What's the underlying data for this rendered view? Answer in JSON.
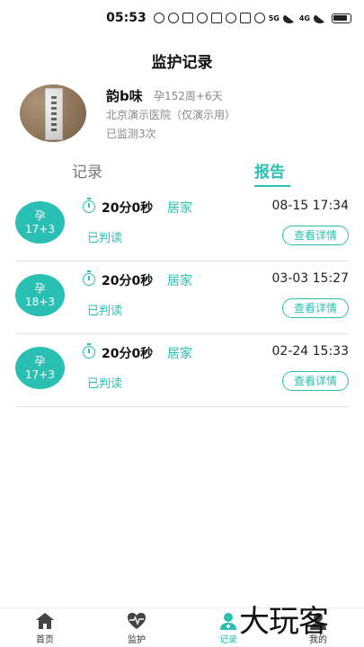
{
  "status_bar": {
    "time": "05:53",
    "icons": [
      "speed-icon",
      "eye-icon",
      "nfc-icon",
      "alarm-icon",
      "bluetooth-icon",
      "moon-icon",
      "vibrate-icon",
      "wifi-icon",
      "signal-icon",
      "signal-icon",
      "battery-icon"
    ],
    "net_5g": "5G",
    "net_4g": "4G"
  },
  "header": {
    "title": "监护记录"
  },
  "profile": {
    "name": "韵b味",
    "pregnancy": "孕152周+6天",
    "hospital": "北京演示医院（仅演示用）",
    "count": "已监测3次"
  },
  "tabs": [
    {
      "label": "记录",
      "active": false
    },
    {
      "label": "报告",
      "active": true
    }
  ],
  "records": [
    {
      "badge_top": "孕",
      "badge_bottom": "17+3",
      "duration": "20分0秒",
      "location": "居家",
      "datetime": "08-15 17:34",
      "status": "已判读",
      "action": "查看详情"
    },
    {
      "badge_top": "孕",
      "badge_bottom": "18+3",
      "duration": "20分0秒",
      "location": "居家",
      "datetime": "03-03 15:27",
      "status": "已判读",
      "action": "查看详情"
    },
    {
      "badge_top": "孕",
      "badge_bottom": "17+3",
      "duration": "20分0秒",
      "location": "居家",
      "datetime": "02-24 15:33",
      "status": "已判读",
      "action": "查看详情"
    }
  ],
  "bottom_nav": [
    {
      "label": "首页",
      "icon": "home-icon"
    },
    {
      "label": "监护",
      "icon": "heartbeat-icon"
    },
    {
      "label": "记录",
      "icon": "doctor-icon",
      "active": true
    },
    {
      "label": "我的",
      "icon": "user-icon"
    }
  ],
  "watermark": "大玩客",
  "colors": {
    "accent": "#29bfb2",
    "text": "#111111",
    "muted": "#888888"
  }
}
